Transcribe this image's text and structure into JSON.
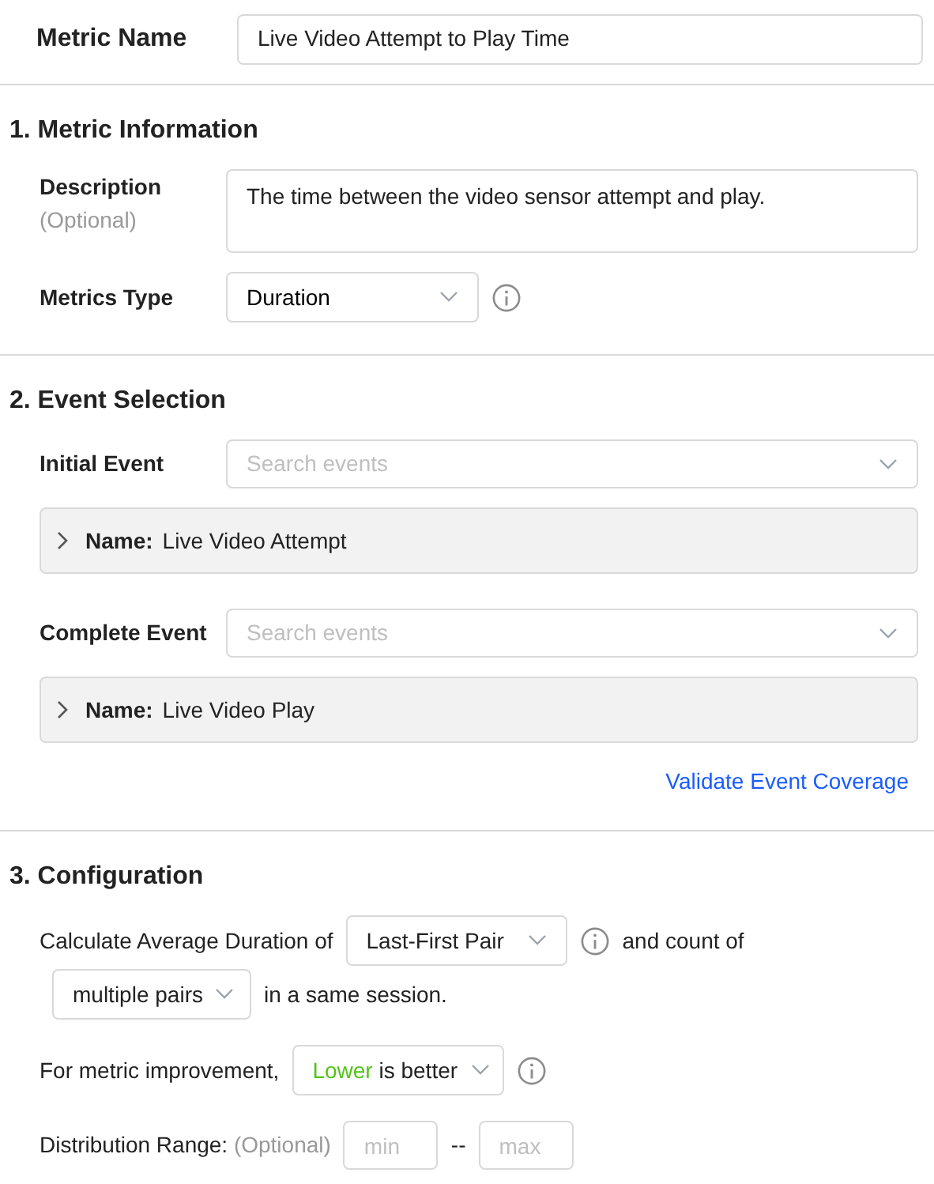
{
  "metric_name": {
    "label": "Metric Name",
    "value": "Live Video Attempt to Play Time"
  },
  "sections": [
    {
      "kind": "info",
      "title": "1. Metric Information",
      "description": {
        "label": "Description",
        "hint": "(Optional)",
        "value": "The time between the video sensor attempt and play."
      },
      "metrics_type": {
        "label": "Metrics Type",
        "value": "Duration"
      }
    },
    {
      "kind": "events",
      "title": "2. Event Selection",
      "events": [
        {
          "label": "Initial Event",
          "placeholder": "Search events",
          "name_label": "Name:",
          "name": "Live Video Attempt",
          "expanded": false
        },
        {
          "label": "Complete Event",
          "placeholder": "Search events",
          "name_label": "Name:",
          "name": "Live Video Play",
          "expanded": false
        }
      ],
      "link": "Validate Event Coverage"
    },
    {
      "kind": "config",
      "title": "3. Configuration",
      "calc_prefix": "Calculate Average Duration of",
      "pair_value": "Last-First Pair",
      "count_text": "and count of",
      "count_value": "multiple pairs",
      "session_text": "in a same session.",
      "improvement_label": "For metric improvement,",
      "improvement_highlight": "Lower",
      "improvement_rest": " is better",
      "range_label": "Distribution Range:",
      "range_hint": "(Optional)",
      "min_placeholder": "min",
      "separator": "--",
      "max_placeholder": "max"
    }
  ]
}
